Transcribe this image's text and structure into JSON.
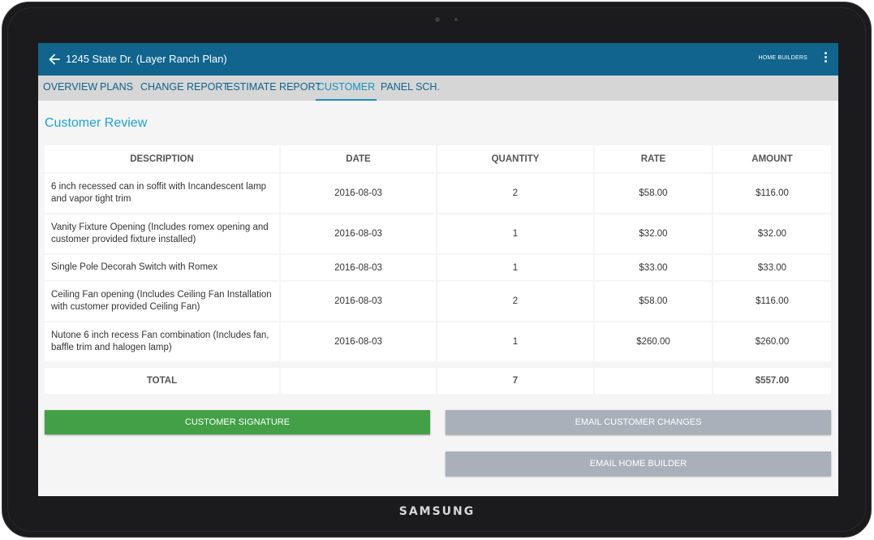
{
  "device": {
    "brand": "SAMSUNG"
  },
  "appbar": {
    "title": "1245 State Dr. (Layer Ranch Plan)",
    "action_label": "HOME BUILDERS"
  },
  "tabs": [
    {
      "label": "OVERVIEW"
    },
    {
      "label": "PLANS"
    },
    {
      "label": "CHANGE REPORT"
    },
    {
      "label": "ESTIMATE REPORT"
    },
    {
      "label": "CUSTOMER",
      "active": true
    },
    {
      "label": "PANEL SCH."
    }
  ],
  "section_title": "Customer Review",
  "table": {
    "headers": [
      "DESCRIPTION",
      "DATE",
      "QUANTITY",
      "RATE",
      "AMOUNT"
    ],
    "rows": [
      {
        "description": "6 inch recessed can in soffit with Incandescent lamp and vapor tight trim",
        "date": "2016-08-03",
        "quantity": "2",
        "rate": "$58.00",
        "amount": "$116.00"
      },
      {
        "description": "Vanity Fixture Opening (Includes romex opening and customer provided fixture installed)",
        "date": "2016-08-03",
        "quantity": "1",
        "rate": "$32.00",
        "amount": "$32.00"
      },
      {
        "description": "Single Pole Decorah Switch with Romex",
        "date": "2016-08-03",
        "quantity": "1",
        "rate": "$33.00",
        "amount": "$33.00"
      },
      {
        "description": "Ceiling Fan opening (Includes Ceiling Fan Installation with customer provided Ceiling Fan)",
        "date": "2016-08-03",
        "quantity": "2",
        "rate": "$58.00",
        "amount": "$116.00"
      },
      {
        "description": "Nutone 6 inch recess Fan combination (Includes fan, baffle trim and halogen lamp)",
        "date": "2016-08-03",
        "quantity": "1",
        "rate": "$260.00",
        "amount": "$260.00"
      }
    ],
    "total": {
      "label": "TOTAL",
      "quantity": "7",
      "amount": "$557.00"
    }
  },
  "buttons": {
    "customer_signature": "CUSTOMER SIGNATURE",
    "email_customer_changes": "EMAIL CUSTOMER CHANGES",
    "email_home_builder": "EMAIL HOME BUILDER"
  },
  "colors": {
    "appbar": "#10648e",
    "tab_bar": "#d6d6d6",
    "accent": "#1692bd",
    "signature_button": "#43a047",
    "email_button": "#a9b0b9"
  },
  "icons": {
    "back": "arrow-back-icon",
    "overflow": "more-vert-icon"
  }
}
